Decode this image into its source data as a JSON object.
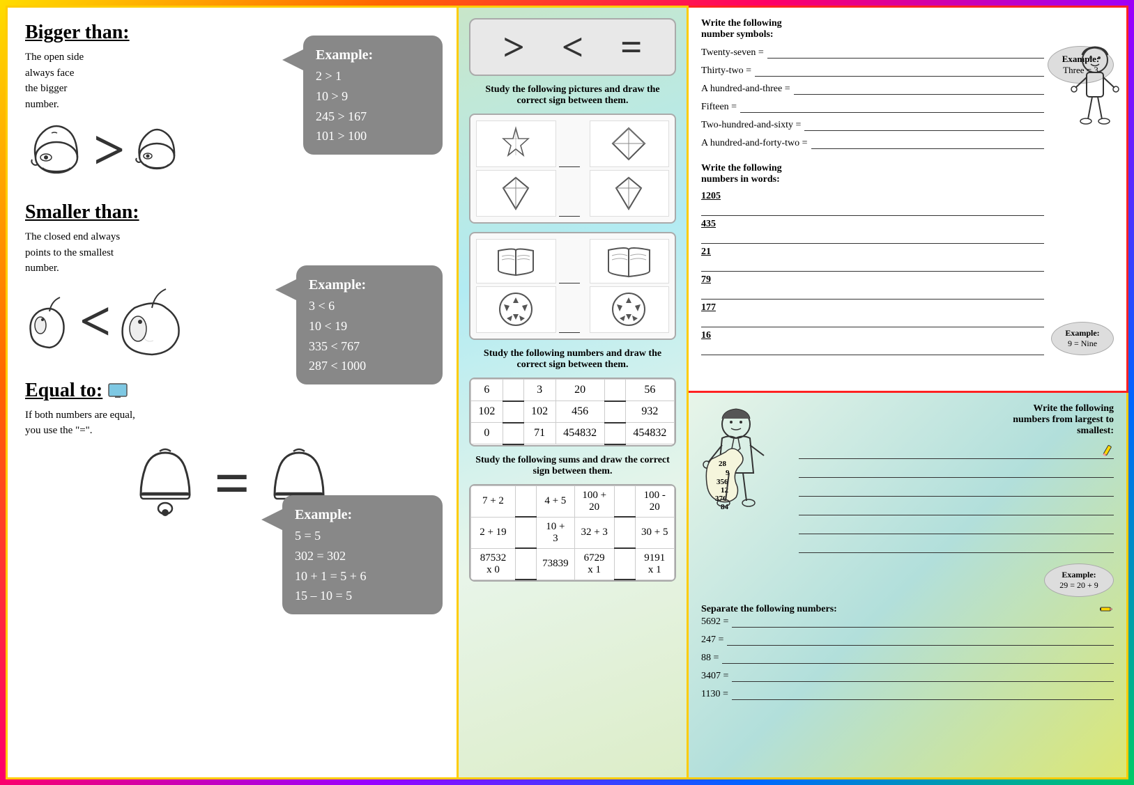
{
  "left": {
    "bigger_title": "Bigger than:",
    "bigger_desc": "The open side\nalways face\nthe bigger\nnumber.",
    "bigger_symbol": ">",
    "bigger_example_title": "Example:",
    "bigger_examples": [
      "2 > 1",
      "10 > 9",
      "245 > 167",
      "101 > 100"
    ],
    "smaller_title": "Smaller than:",
    "smaller_desc": "The closed end always\npoints to the smallest\nnumber.",
    "smaller_symbol": "<",
    "smaller_example_title": "Example:",
    "smaller_examples": [
      "3 < 6",
      "10 < 19",
      "335 < 767",
      "287 < 1000"
    ],
    "equal_title": "Equal to:",
    "equal_desc": "If both numbers are equal,\nyou use the \"=\".",
    "equal_symbol": "=",
    "equal_example_title": "Example:",
    "equal_examples": [
      "5 = 5",
      "302 = 302",
      "10 + 1 = 5 + 6",
      "15 – 10 = 5"
    ]
  },
  "middle": {
    "symbols": [
      ">",
      "<",
      "="
    ],
    "pics_instruction": "Study the following pictures and draw the\ncorrect sign between them.",
    "numbers_instruction": "Study the following numbers and draw the\ncorrect sign between them.",
    "sums_instruction": "Study the following sums and draw the correct\nsign between them.",
    "number_pairs": [
      [
        "6",
        "3"
      ],
      [
        "102",
        "102"
      ],
      [
        "0",
        "71"
      ],
      [
        "20",
        "56"
      ],
      [
        "456",
        "932"
      ],
      [
        "454832",
        "454832"
      ]
    ],
    "sum_pairs": [
      [
        "7 + 2",
        "4 + 5"
      ],
      [
        "2 + 19",
        "10 + 3"
      ],
      [
        "87532 x 0",
        "73839"
      ],
      [
        "100 + 20",
        "100 - 20"
      ],
      [
        "32 + 3",
        "30 + 5"
      ],
      [
        "6729 x 1",
        "9191 x 1"
      ]
    ]
  },
  "right_top": {
    "title": "Write the following\nnumber symbols:",
    "rows": [
      "Twenty-seven =",
      "Thirty-two =",
      "A hundred-and-three =",
      "Fifteen =",
      "Two-hundred-and-sixty =",
      "A hundred-and-forty-two ="
    ],
    "example_label": "Example:",
    "example_value": "Three = 3",
    "words_title": "Write the following\nnumbers in words:",
    "word_rows": [
      "1205",
      "435",
      "21",
      "79",
      "177",
      "16"
    ],
    "words_example_label": "Example:",
    "words_example_value": "9 = Nine"
  },
  "right_bottom": {
    "title": "Write the following\nnumbers from largest to\nsmallest:",
    "numbers": [
      "28",
      "9",
      "356",
      "12",
      "376",
      "84"
    ],
    "example_label": "Example:",
    "example_value": "29 = 20 + 9",
    "separate_title": "Separate the following numbers:",
    "separate_rows": [
      "5692 =",
      "247 =",
      "88 =",
      "3407 =",
      "1130 ="
    ]
  }
}
